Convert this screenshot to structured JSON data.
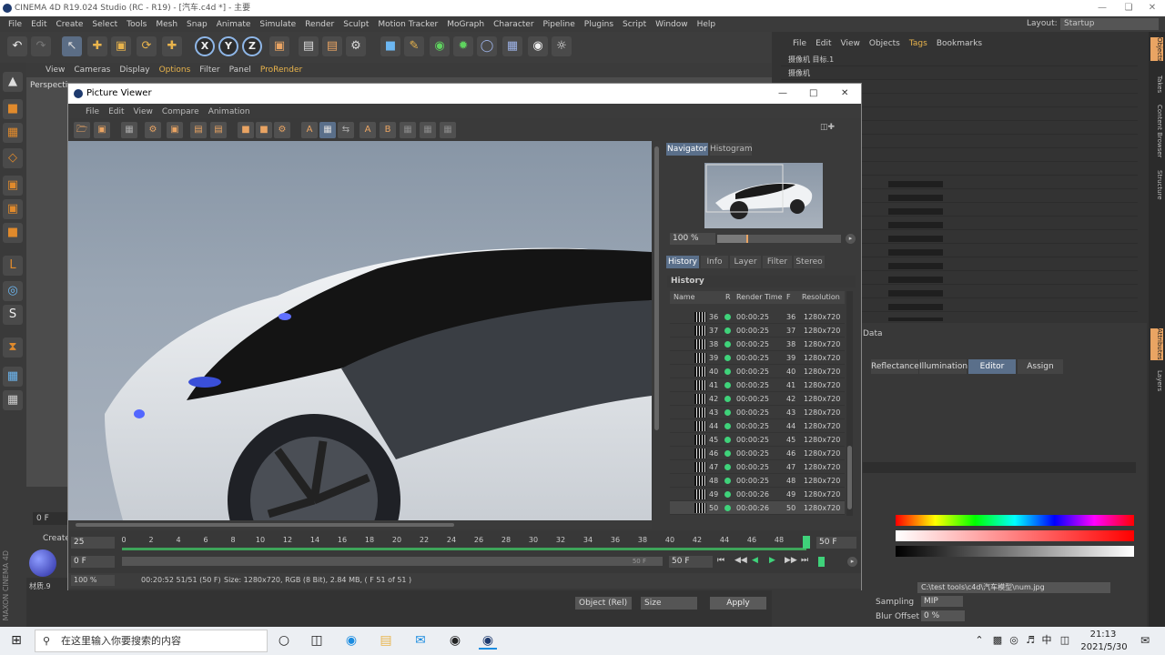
{
  "window": {
    "title": "CINEMA 4D R19.024 Studio (RC - R19) - [汽车.c4d *] - 主要"
  },
  "menubar": [
    "File",
    "Edit",
    "Create",
    "Select",
    "Tools",
    "Mesh",
    "Snap",
    "Animate",
    "Simulate",
    "Render",
    "Sculpt",
    "Motion Tracker",
    "MoGraph",
    "Character",
    "Pipeline",
    "Plugins",
    "Script",
    "Window",
    "Help"
  ],
  "layout": {
    "label": "Layout:",
    "value": "Startup"
  },
  "viewport": {
    "menu": [
      "View",
      "Cameras",
      "Display",
      "Options",
      "Filter",
      "Panel",
      "ProRender"
    ],
    "label": "Perspective"
  },
  "object_manager": {
    "menu": [
      "File",
      "Edit",
      "View",
      "Objects",
      "Tags",
      "Bookmarks"
    ],
    "rows": [
      "摄像机 目标.1",
      "摄像机"
    ]
  },
  "side_tabs": [
    "Objects",
    "Takes",
    "Content Browser",
    "Structure",
    "Attributes",
    "Layers"
  ],
  "attributes": {
    "label": "Data",
    "tabs": [
      "Reflectance",
      "Illumination",
      "Editor",
      "Assign"
    ],
    "path": "C:\\test tools\\c4d\\汽车模型\\num.jpg",
    "sampling_label": "Sampling",
    "sampling_value": "MIP",
    "blur_label": "Blur Offset",
    "blur_value": "0 %",
    "bottom_controls": [
      "Object (Rel)",
      "Size",
      "Apply"
    ]
  },
  "timeline_bg": {
    "create_label": "Create",
    "frame_field": "0 F",
    "material_label": "材质.9"
  },
  "picture_viewer": {
    "title": "Picture Viewer",
    "menu": [
      "File",
      "Edit",
      "View",
      "Compare",
      "Animation"
    ],
    "nav_tabs": [
      "Navigator",
      "Histogram"
    ],
    "zoom": "100 %",
    "hist_tabs": [
      "History",
      "Info",
      "Layer",
      "Filter",
      "Stereo"
    ],
    "history_label": "History",
    "columns": [
      "Name",
      "R",
      "Render Time",
      "F",
      "Resolution"
    ],
    "history": [
      {
        "n": "36",
        "t": "00:00:25",
        "f": "36",
        "r": "1280x720"
      },
      {
        "n": "37",
        "t": "00:00:25",
        "f": "37",
        "r": "1280x720"
      },
      {
        "n": "38",
        "t": "00:00:25",
        "f": "38",
        "r": "1280x720"
      },
      {
        "n": "39",
        "t": "00:00:25",
        "f": "39",
        "r": "1280x720"
      },
      {
        "n": "40",
        "t": "00:00:25",
        "f": "40",
        "r": "1280x720"
      },
      {
        "n": "41",
        "t": "00:00:25",
        "f": "41",
        "r": "1280x720"
      },
      {
        "n": "42",
        "t": "00:00:25",
        "f": "42",
        "r": "1280x720"
      },
      {
        "n": "43",
        "t": "00:00:25",
        "f": "43",
        "r": "1280x720"
      },
      {
        "n": "44",
        "t": "00:00:25",
        "f": "44",
        "r": "1280x720"
      },
      {
        "n": "45",
        "t": "00:00:25",
        "f": "45",
        "r": "1280x720"
      },
      {
        "n": "46",
        "t": "00:00:25",
        "f": "46",
        "r": "1280x720"
      },
      {
        "n": "47",
        "t": "00:00:25",
        "f": "47",
        "r": "1280x720"
      },
      {
        "n": "48",
        "t": "00:00:25",
        "f": "48",
        "r": "1280x720"
      },
      {
        "n": "49",
        "t": "00:00:26",
        "f": "49",
        "r": "1280x720"
      },
      {
        "n": "50",
        "t": "00:00:26",
        "f": "50",
        "r": "1280x720"
      }
    ],
    "fps": "25",
    "ticks": [
      "0",
      "2",
      "4",
      "6",
      "8",
      "10",
      "12",
      "14",
      "16",
      "18",
      "20",
      "22",
      "24",
      "26",
      "28",
      "30",
      "32",
      "34",
      "36",
      "38",
      "40",
      "42",
      "44",
      "46",
      "48"
    ],
    "end_frame": "50 F",
    "start_field": "0 F",
    "range_end": "50 F",
    "current_field": "50 F",
    "status_zoom": "100 %",
    "status_time": "00:20:52 51/51 (50 F)",
    "status_info": "Size: 1280x720, RGB (8 Bit), 2.84 MB,  ( F 51 of 51 )"
  },
  "taskbar": {
    "search": "在这里输入你要搜索的内容",
    "time": "21:13",
    "date": "2021/5/30",
    "ime": "中"
  }
}
